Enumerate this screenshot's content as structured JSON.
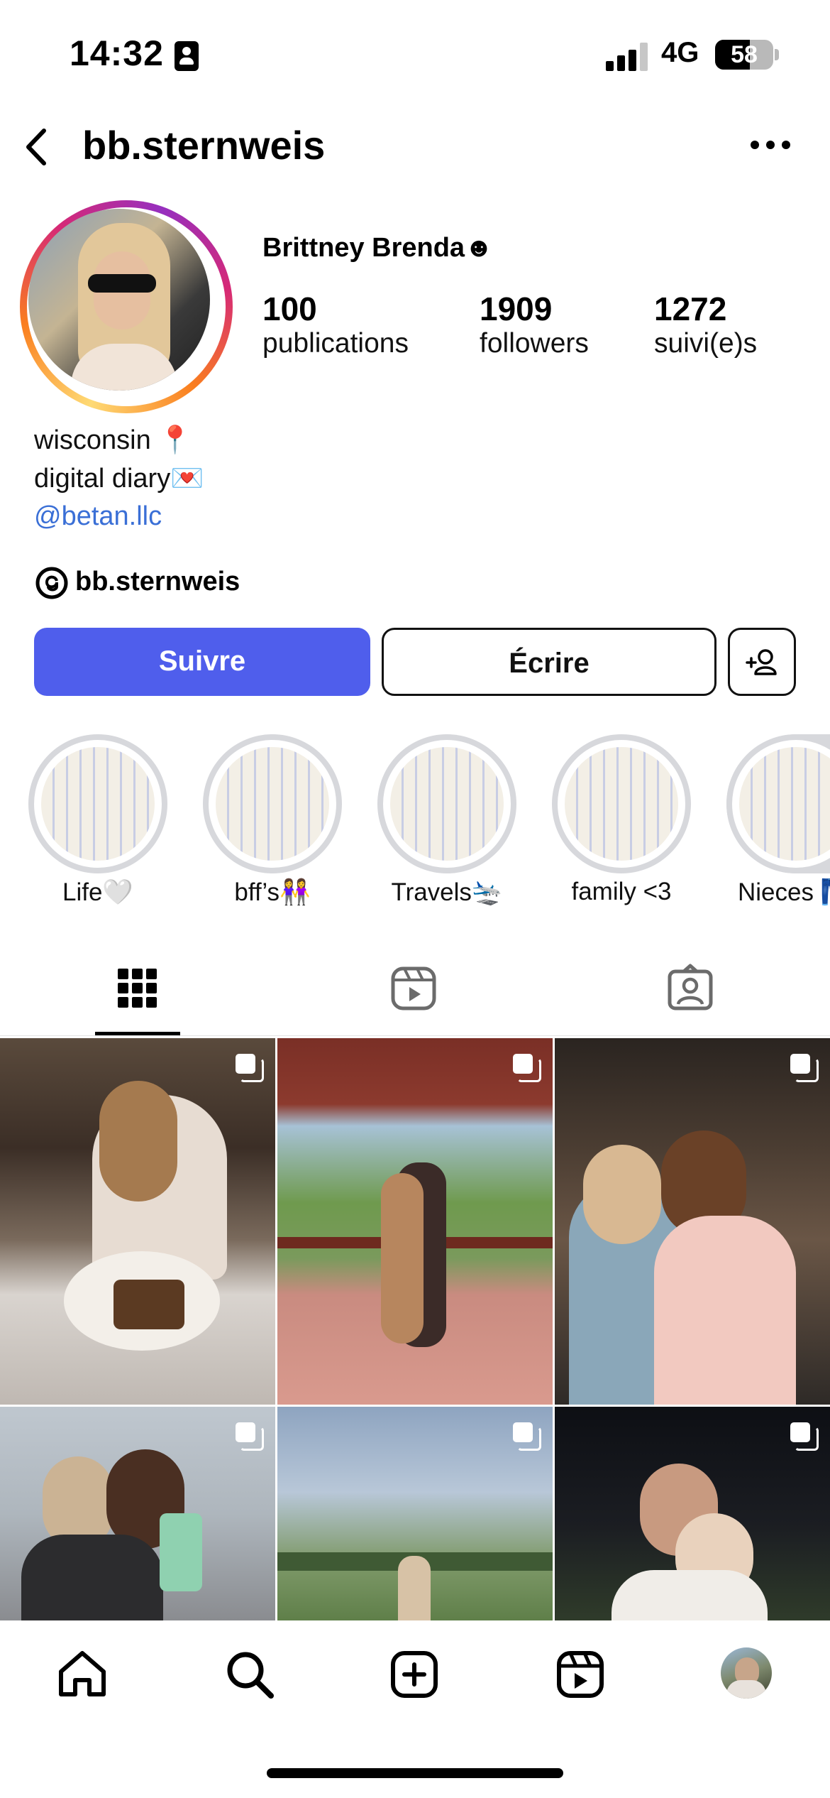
{
  "status_bar": {
    "time": "14:32",
    "network": "4G",
    "battery": "58"
  },
  "header": {
    "username": "bb.sternweis"
  },
  "profile": {
    "full_name": "Brittney Brenda☻",
    "stats": [
      {
        "value": "100",
        "label": "publications"
      },
      {
        "value": "1909",
        "label": "followers"
      },
      {
        "value": "1272",
        "label": "suivi(e)s"
      }
    ],
    "bio_lines": [
      "wisconsin 📍",
      "digital diary💌"
    ],
    "link": "@betan.llc",
    "threads_handle": "bb.sternweis"
  },
  "actions": {
    "follow": "Suivre",
    "message": "Écrire"
  },
  "highlights": [
    {
      "label": "Life🤍"
    },
    {
      "label": "bff’s👭"
    },
    {
      "label": "Travels🛬"
    },
    {
      "label": "family <3"
    },
    {
      "label": "Nieces👖"
    }
  ],
  "tabs": [
    "grid-icon",
    "reels-icon",
    "tagged-icon"
  ],
  "posts_count_visible": 6,
  "nav": [
    "home-icon",
    "search-icon",
    "create-icon",
    "reels-icon",
    "profile-avatar"
  ]
}
